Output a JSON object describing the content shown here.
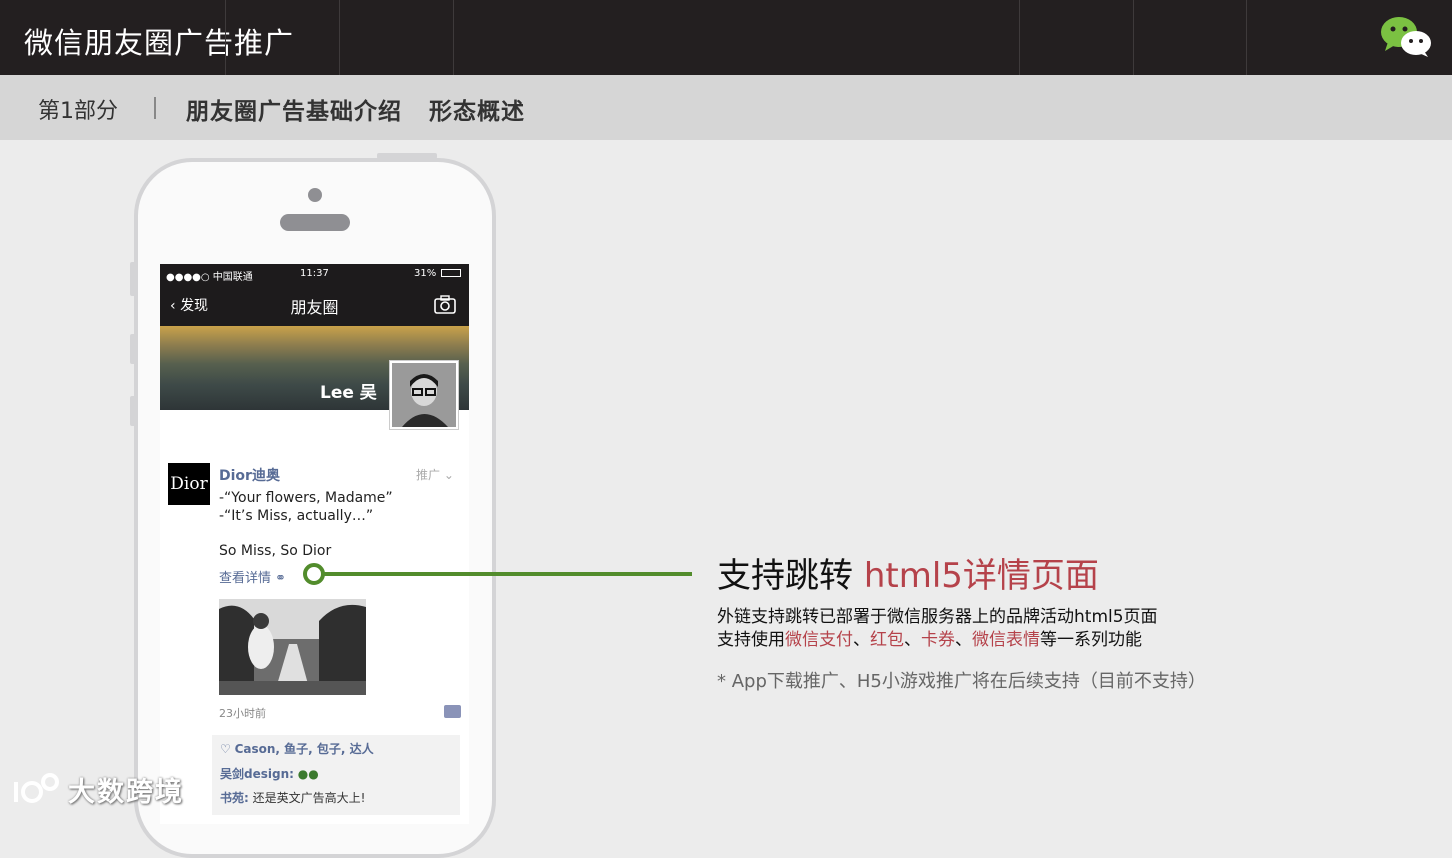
{
  "header": {
    "title": "微信朋友圈广告推广",
    "logo_icon": "wechat-logo-icon"
  },
  "section": {
    "part": "第1部分",
    "separator": "|",
    "heading": "朋友圈广告基础介绍   形态概述"
  },
  "phone": {
    "status": {
      "signal": "●●●●○ 中国联通",
      "time": "11:37",
      "battery": "31%"
    },
    "nav": {
      "back": "发现",
      "title": "朋友圈",
      "camera_icon": "camera-icon"
    },
    "profile_name": "Lee 吴",
    "post": {
      "brand_logo": "Dior",
      "author": "Dior迪奥",
      "tag": "推广",
      "lines": [
        "-“Your flowers, Madame”",
        "-“It’s Miss, actually…”",
        "So Miss, So Dior"
      ],
      "link": "查看详情",
      "time": "23小时前"
    },
    "likes": {
      "names": "Cason, 鱼子, 包子, 达人"
    },
    "comments": [
      {
        "user": "吴剑design:",
        "text": ""
      },
      {
        "user": "书苑:",
        "text": "还是英文广告高大上!"
      }
    ]
  },
  "callout": {
    "title": "支持跳转",
    "title_highlight": "html5详情页面",
    "line1": "外链支持跳转已部署于微信服务器上的品牌活动html5页面",
    "line2_prefix": "支持使用",
    "features": [
      "微信支付",
      "红包",
      "卡券",
      "微信表情"
    ],
    "delim": "、",
    "line2_suffix": "等一系列功能",
    "note": "* App下载推广、H5小游戏推广将在后续支持（目前不支持）"
  },
  "watermark": {
    "text": "大数跨境"
  },
  "colors": {
    "topbar": "#231f20",
    "accent_green": "#528c2c",
    "highlight_red": "#b5424a",
    "link_blue": "#576b95"
  }
}
